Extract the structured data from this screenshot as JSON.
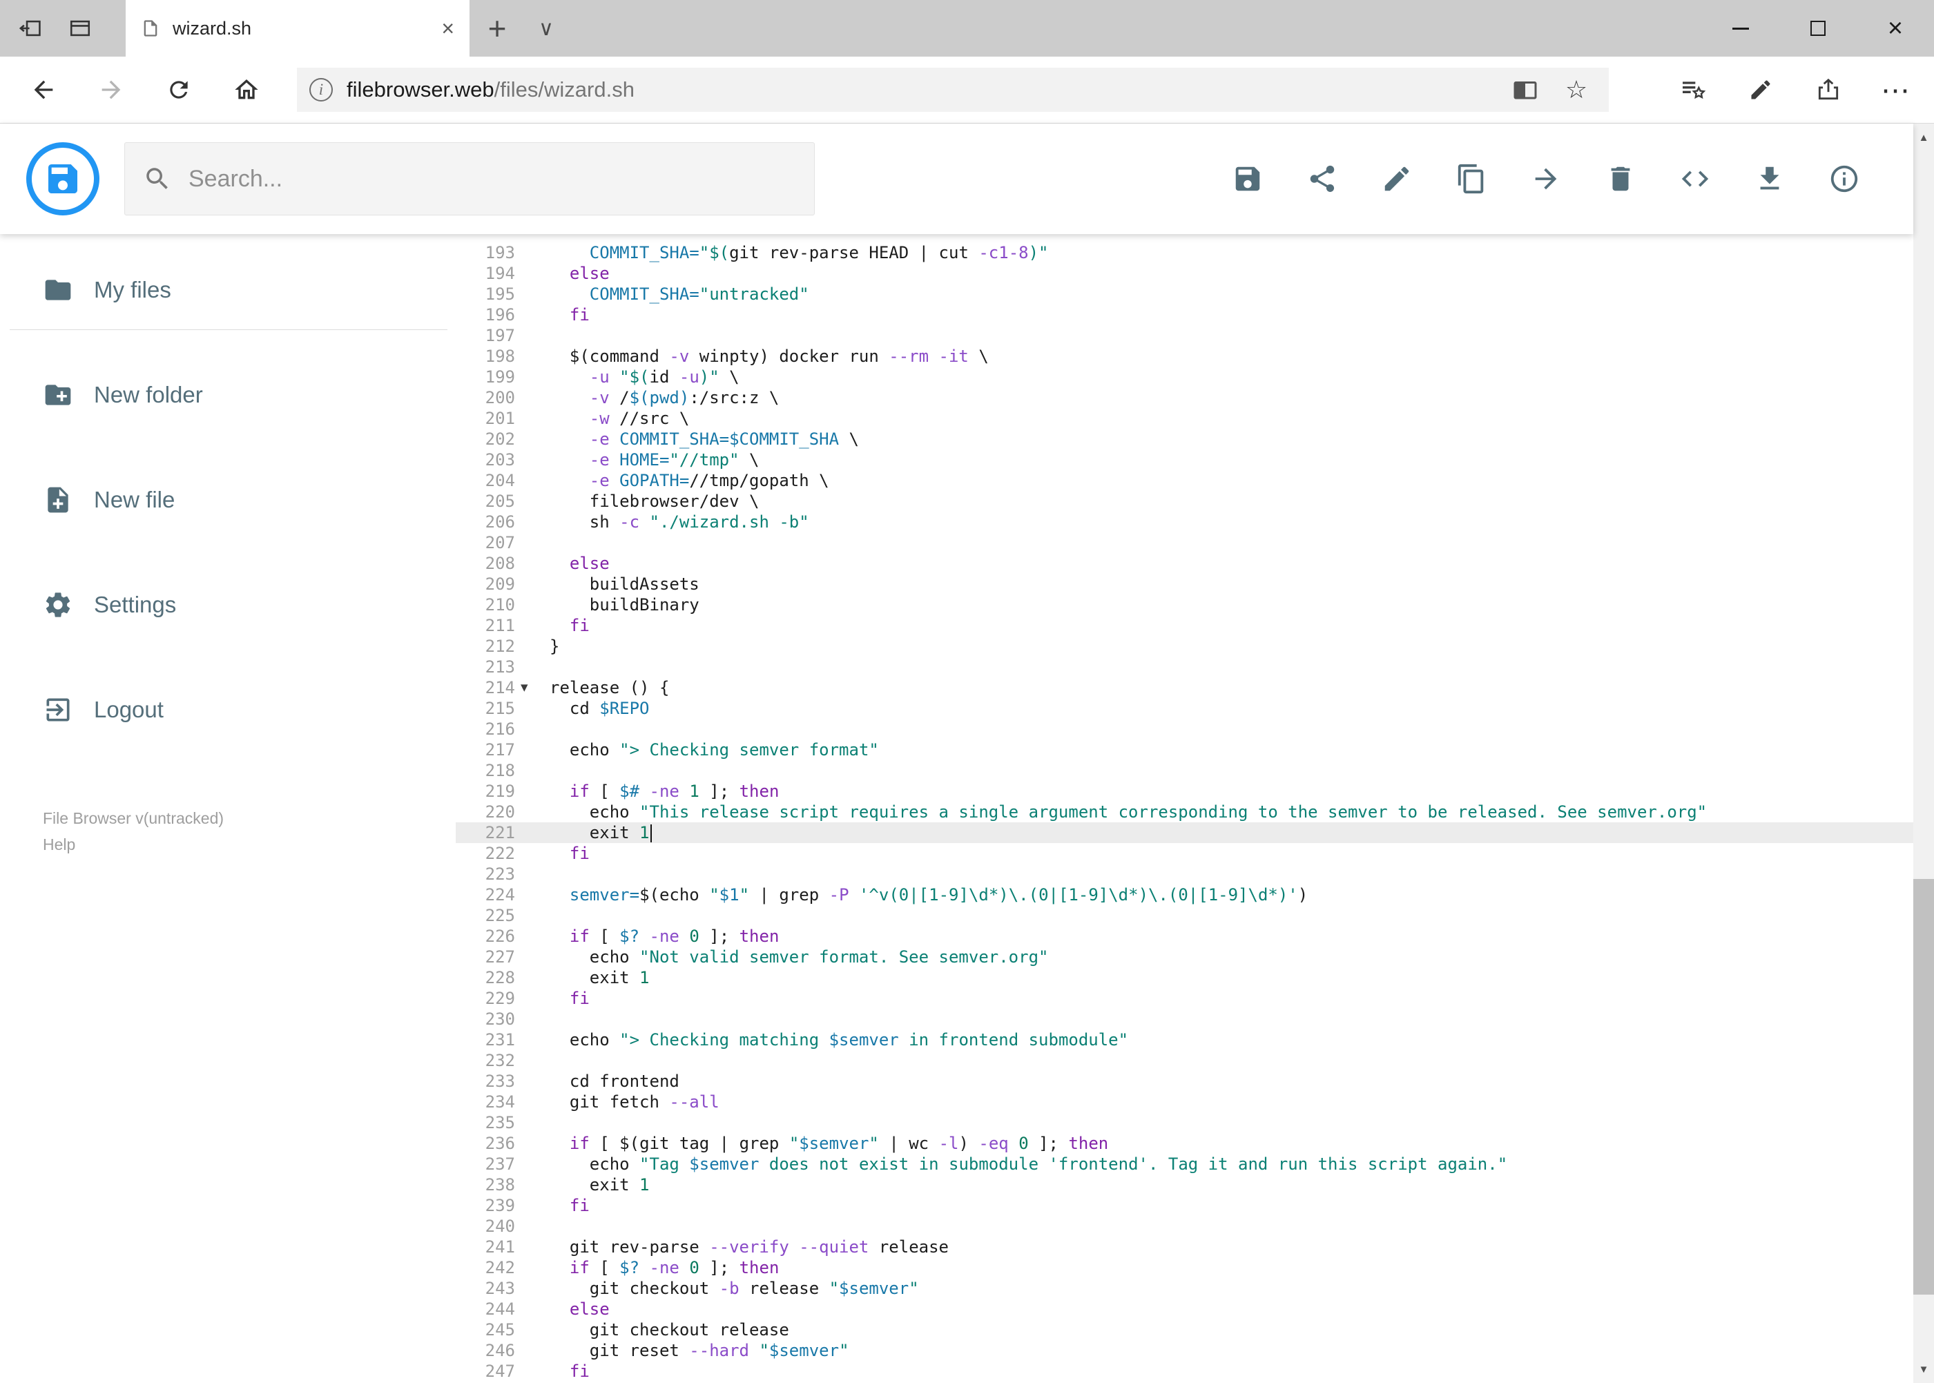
{
  "browser": {
    "tab_title": "wizard.sh",
    "url_domain": "filebrowser.web",
    "url_path": "/files/wizard.sh"
  },
  "glyphs": {
    "close": "×",
    "new_tab": "+",
    "tab_chevron": "∨",
    "star": "☆",
    "ellipsis": "⋯",
    "scroll_up": "▲",
    "scroll_down": "▼",
    "fold": "▾",
    "info_i": "i"
  },
  "app": {
    "search_placeholder": "Search...",
    "toolbar_icons": [
      "save",
      "share",
      "edit",
      "copy",
      "move",
      "delete",
      "code",
      "download",
      "info"
    ],
    "sidebar": {
      "items": [
        {
          "label": "My files",
          "icon": "folder"
        },
        {
          "label": "New folder",
          "icon": "create-new-folder"
        },
        {
          "label": "New file",
          "icon": "note-add"
        },
        {
          "label": "Settings",
          "icon": "settings"
        },
        {
          "label": "Logout",
          "icon": "logout"
        }
      ],
      "version": "File Browser v(untracked)",
      "help": "Help"
    }
  },
  "editor": {
    "first_line": 193,
    "last_line": 247,
    "active_line": 221,
    "lines": [
      {
        "n": 193,
        "seg": [
          [
            "    ",
            "p"
          ],
          [
            "COMMIT_SHA=",
            "v"
          ],
          [
            "\"$(",
            "s"
          ],
          [
            "git rev-parse HEAD | cut ",
            "p"
          ],
          [
            "-c1-8",
            "f"
          ],
          [
            ")\"",
            "s"
          ]
        ]
      },
      {
        "n": 194,
        "seg": [
          [
            "  ",
            "p"
          ],
          [
            "else",
            "k"
          ]
        ]
      },
      {
        "n": 195,
        "seg": [
          [
            "    ",
            "p"
          ],
          [
            "COMMIT_SHA=",
            "v"
          ],
          [
            "\"untracked\"",
            "s"
          ]
        ]
      },
      {
        "n": 196,
        "seg": [
          [
            "  ",
            "p"
          ],
          [
            "fi",
            "k"
          ]
        ]
      },
      {
        "n": 197,
        "seg": []
      },
      {
        "n": 198,
        "seg": [
          [
            "  $(command ",
            "p"
          ],
          [
            "-v",
            "f"
          ],
          [
            " winpty) docker run ",
            "p"
          ],
          [
            "--rm",
            "f"
          ],
          [
            " ",
            "p"
          ],
          [
            "-it",
            "f"
          ],
          [
            " \\",
            "p"
          ]
        ]
      },
      {
        "n": 199,
        "seg": [
          [
            "    ",
            "p"
          ],
          [
            "-u",
            "f"
          ],
          [
            " ",
            "p"
          ],
          [
            "\"$(",
            "s"
          ],
          [
            "id ",
            "p"
          ],
          [
            "-u",
            "f"
          ],
          [
            ")\"",
            "s"
          ],
          [
            " \\",
            "p"
          ]
        ]
      },
      {
        "n": 200,
        "seg": [
          [
            "    ",
            "p"
          ],
          [
            "-v",
            "f"
          ],
          [
            " /",
            "p"
          ],
          [
            "$(pwd)",
            "v"
          ],
          [
            ":/src:z \\",
            "p"
          ]
        ]
      },
      {
        "n": 201,
        "seg": [
          [
            "    ",
            "p"
          ],
          [
            "-w",
            "f"
          ],
          [
            " //src \\",
            "p"
          ]
        ]
      },
      {
        "n": 202,
        "seg": [
          [
            "    ",
            "p"
          ],
          [
            "-e",
            "f"
          ],
          [
            " ",
            "p"
          ],
          [
            "COMMIT_SHA=$COMMIT_SHA",
            "v"
          ],
          [
            " \\",
            "p"
          ]
        ]
      },
      {
        "n": 203,
        "seg": [
          [
            "    ",
            "p"
          ],
          [
            "-e",
            "f"
          ],
          [
            " ",
            "p"
          ],
          [
            "HOME=",
            "v"
          ],
          [
            "\"//tmp\"",
            "s"
          ],
          [
            " \\",
            "p"
          ]
        ]
      },
      {
        "n": 204,
        "seg": [
          [
            "    ",
            "p"
          ],
          [
            "-e",
            "f"
          ],
          [
            " ",
            "p"
          ],
          [
            "GOPATH=",
            "v"
          ],
          [
            "//tmp/gopath \\",
            "p"
          ]
        ]
      },
      {
        "n": 205,
        "seg": [
          [
            "    filebrowser/dev \\",
            "p"
          ]
        ]
      },
      {
        "n": 206,
        "seg": [
          [
            "    sh ",
            "p"
          ],
          [
            "-c",
            "f"
          ],
          [
            " ",
            "p"
          ],
          [
            "\"./wizard.sh -b\"",
            "s"
          ]
        ]
      },
      {
        "n": 207,
        "seg": []
      },
      {
        "n": 208,
        "seg": [
          [
            "  ",
            "p"
          ],
          [
            "else",
            "k"
          ]
        ]
      },
      {
        "n": 209,
        "seg": [
          [
            "    buildAssets",
            "p"
          ]
        ]
      },
      {
        "n": 210,
        "seg": [
          [
            "    buildBinary",
            "p"
          ]
        ]
      },
      {
        "n": 211,
        "seg": [
          [
            "  ",
            "p"
          ],
          [
            "fi",
            "k"
          ]
        ]
      },
      {
        "n": 212,
        "seg": [
          [
            "}",
            "p"
          ]
        ]
      },
      {
        "n": 213,
        "seg": []
      },
      {
        "n": 214,
        "fold": true,
        "seg": [
          [
            "release () {",
            "p"
          ]
        ]
      },
      {
        "n": 215,
        "seg": [
          [
            "  cd ",
            "p"
          ],
          [
            "$REPO",
            "v"
          ]
        ]
      },
      {
        "n": 216,
        "seg": []
      },
      {
        "n": 217,
        "seg": [
          [
            "  echo ",
            "p"
          ],
          [
            "\"> Checking semver format\"",
            "s"
          ]
        ]
      },
      {
        "n": 218,
        "seg": []
      },
      {
        "n": 219,
        "seg": [
          [
            "  ",
            "p"
          ],
          [
            "if",
            "k"
          ],
          [
            " [ ",
            "p"
          ],
          [
            "$#",
            "v"
          ],
          [
            " ",
            "p"
          ],
          [
            "-ne",
            "f"
          ],
          [
            " ",
            "p"
          ],
          [
            "1",
            "n"
          ],
          [
            " ]; ",
            "p"
          ],
          [
            "then",
            "k"
          ]
        ]
      },
      {
        "n": 220,
        "seg": [
          [
            "    echo ",
            "p"
          ],
          [
            "\"This release script requires a single argument corresponding to the semver to be released. See semver.org\"",
            "s"
          ]
        ]
      },
      {
        "n": 221,
        "cursor": true,
        "seg": [
          [
            "    exit ",
            "p"
          ],
          [
            "1",
            "n"
          ]
        ]
      },
      {
        "n": 222,
        "seg": [
          [
            "  ",
            "p"
          ],
          [
            "fi",
            "k"
          ]
        ]
      },
      {
        "n": 223,
        "seg": []
      },
      {
        "n": 224,
        "seg": [
          [
            "  ",
            "p"
          ],
          [
            "semver=",
            "v"
          ],
          [
            "$(echo ",
            "p"
          ],
          [
            "\"",
            "s"
          ],
          [
            "$1",
            "v"
          ],
          [
            "\"",
            "s"
          ],
          [
            " | grep ",
            "p"
          ],
          [
            "-P",
            "f"
          ],
          [
            " ",
            "p"
          ],
          [
            "'^v(0|[1-9]\\d*)\\.(0|[1-9]\\d*)\\.(0|[1-9]\\d*)'",
            "s"
          ],
          [
            ")",
            "p"
          ]
        ]
      },
      {
        "n": 225,
        "seg": []
      },
      {
        "n": 226,
        "seg": [
          [
            "  ",
            "p"
          ],
          [
            "if",
            "k"
          ],
          [
            " [ ",
            "p"
          ],
          [
            "$?",
            "v"
          ],
          [
            " ",
            "p"
          ],
          [
            "-ne",
            "f"
          ],
          [
            " ",
            "p"
          ],
          [
            "0",
            "n"
          ],
          [
            " ]; ",
            "p"
          ],
          [
            "then",
            "k"
          ]
        ]
      },
      {
        "n": 227,
        "seg": [
          [
            "    echo ",
            "p"
          ],
          [
            "\"Not valid semver format. See semver.org\"",
            "s"
          ]
        ]
      },
      {
        "n": 228,
        "seg": [
          [
            "    exit ",
            "p"
          ],
          [
            "1",
            "n"
          ]
        ]
      },
      {
        "n": 229,
        "seg": [
          [
            "  ",
            "p"
          ],
          [
            "fi",
            "k"
          ]
        ]
      },
      {
        "n": 230,
        "seg": []
      },
      {
        "n": 231,
        "seg": [
          [
            "  echo ",
            "p"
          ],
          [
            "\"> Checking matching ",
            "s"
          ],
          [
            "$semver",
            "v"
          ],
          [
            " in frontend submodule\"",
            "s"
          ]
        ]
      },
      {
        "n": 232,
        "seg": []
      },
      {
        "n": 233,
        "seg": [
          [
            "  cd frontend",
            "p"
          ]
        ]
      },
      {
        "n": 234,
        "seg": [
          [
            "  git fetch ",
            "p"
          ],
          [
            "--all",
            "f"
          ]
        ]
      },
      {
        "n": 235,
        "seg": []
      },
      {
        "n": 236,
        "seg": [
          [
            "  ",
            "p"
          ],
          [
            "if",
            "k"
          ],
          [
            " [ ",
            "p"
          ],
          [
            "$(git tag | grep ",
            "p"
          ],
          [
            "\"",
            "s"
          ],
          [
            "$semver",
            "v"
          ],
          [
            "\"",
            "s"
          ],
          [
            " | wc ",
            "p"
          ],
          [
            "-l",
            "f"
          ],
          [
            ") ",
            "p"
          ],
          [
            "-eq",
            "f"
          ],
          [
            " ",
            "p"
          ],
          [
            "0",
            "n"
          ],
          [
            " ]; ",
            "p"
          ],
          [
            "then",
            "k"
          ]
        ]
      },
      {
        "n": 237,
        "seg": [
          [
            "    echo ",
            "p"
          ],
          [
            "\"Tag ",
            "s"
          ],
          [
            "$semver",
            "v"
          ],
          [
            " does not exist in submodule 'frontend'. Tag it and run this script again.\"",
            "s"
          ]
        ]
      },
      {
        "n": 238,
        "seg": [
          [
            "    exit ",
            "p"
          ],
          [
            "1",
            "n"
          ]
        ]
      },
      {
        "n": 239,
        "seg": [
          [
            "  ",
            "p"
          ],
          [
            "fi",
            "k"
          ]
        ]
      },
      {
        "n": 240,
        "seg": []
      },
      {
        "n": 241,
        "seg": [
          [
            "  git rev-parse ",
            "p"
          ],
          [
            "--verify",
            "f"
          ],
          [
            " ",
            "p"
          ],
          [
            "--quiet",
            "f"
          ],
          [
            " release",
            "p"
          ]
        ]
      },
      {
        "n": 242,
        "seg": [
          [
            "  ",
            "p"
          ],
          [
            "if",
            "k"
          ],
          [
            " [ ",
            "p"
          ],
          [
            "$?",
            "v"
          ],
          [
            " ",
            "p"
          ],
          [
            "-ne",
            "f"
          ],
          [
            " ",
            "p"
          ],
          [
            "0",
            "n"
          ],
          [
            " ]; ",
            "p"
          ],
          [
            "then",
            "k"
          ]
        ]
      },
      {
        "n": 243,
        "seg": [
          [
            "    git checkout ",
            "p"
          ],
          [
            "-b",
            "f"
          ],
          [
            " release ",
            "p"
          ],
          [
            "\"",
            "s"
          ],
          [
            "$semver",
            "v"
          ],
          [
            "\"",
            "s"
          ]
        ]
      },
      {
        "n": 244,
        "seg": [
          [
            "  ",
            "p"
          ],
          [
            "else",
            "k"
          ]
        ]
      },
      {
        "n": 245,
        "seg": [
          [
            "    git checkout release",
            "p"
          ]
        ]
      },
      {
        "n": 246,
        "seg": [
          [
            "    git reset ",
            "p"
          ],
          [
            "--hard",
            "f"
          ],
          [
            " ",
            "p"
          ],
          [
            "\"",
            "s"
          ],
          [
            "$semver",
            "v"
          ],
          [
            "\"",
            "s"
          ]
        ]
      },
      {
        "n": 247,
        "seg": [
          [
            "  ",
            "p"
          ],
          [
            "fi",
            "k"
          ]
        ]
      }
    ]
  }
}
